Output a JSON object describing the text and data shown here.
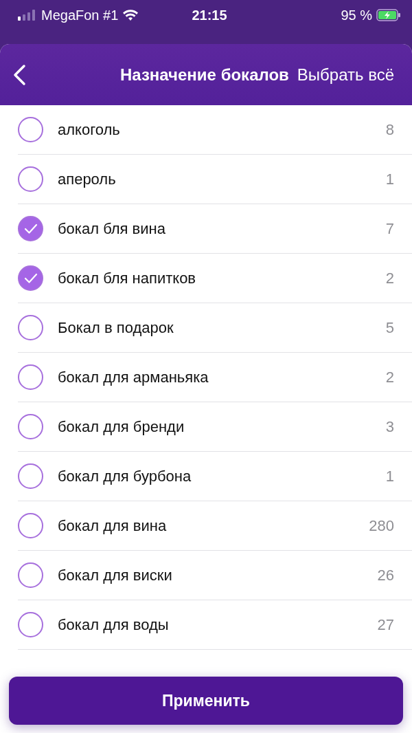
{
  "status_bar": {
    "carrier": "MegaFon #1",
    "time": "21:15",
    "battery": "95 %"
  },
  "sheet": {
    "title": "Назначение бокалов",
    "select_all": "Выбрать всё"
  },
  "items": [
    {
      "label": "алкоголь",
      "count": "8",
      "checked": false
    },
    {
      "label": "апероль",
      "count": "1",
      "checked": false
    },
    {
      "label": "бокал бля вина",
      "count": "7",
      "checked": true
    },
    {
      "label": "бокал бля напитков",
      "count": "2",
      "checked": true
    },
    {
      "label": "Бокал в подарок",
      "count": "5",
      "checked": false
    },
    {
      "label": "бокал для арманьяка",
      "count": "2",
      "checked": false
    },
    {
      "label": "бокал для бренди",
      "count": "3",
      "checked": false
    },
    {
      "label": "бокал для бурбона",
      "count": "1",
      "checked": false
    },
    {
      "label": "бокал для вина",
      "count": "280",
      "checked": false
    },
    {
      "label": "бокал для виски",
      "count": "26",
      "checked": false
    },
    {
      "label": "бокал для воды",
      "count": "27",
      "checked": false
    }
  ],
  "apply_button": "Применить"
}
